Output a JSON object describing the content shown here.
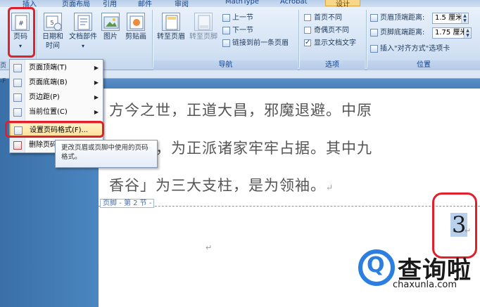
{
  "tabs": [
    {
      "label": "插入"
    },
    {
      "label": "页面布局"
    },
    {
      "label": "引用"
    },
    {
      "label": "邮件"
    },
    {
      "label": "审阅"
    },
    {
      "label": "MathType"
    },
    {
      "label": "Acrobat"
    },
    {
      "label": "设计"
    }
  ],
  "ribbon": {
    "header_footer": {
      "page_number_label": "页码",
      "page_number_arrow": "▾"
    },
    "insert": {
      "datetime_label": "日期和\n时间",
      "quickparts_label": "文档部件",
      "quickparts_arrow": "▾",
      "picture_label": "图片",
      "clipart_label": "剪贴画"
    },
    "navigation": {
      "goto_header_label": "转至页眉",
      "goto_footer_label": "转至页脚",
      "prev_section_label": "上一节",
      "next_section_label": "下一节",
      "link_prev_label": "链接到前一条页眉",
      "title": "导航"
    },
    "options": {
      "diff_first_label": "首页不同",
      "diff_first_checked": false,
      "diff_oddeven_label": "奇偶页不同",
      "diff_oddeven_checked": false,
      "show_text_label": "显示文档文字",
      "show_text_checked": true,
      "title": "选项"
    },
    "position": {
      "header_from_top_label": "页眉顶端距离:",
      "header_from_top_value": "1.5 厘米",
      "footer_from_bottom_label": "页脚底端距离:",
      "footer_from_bottom_value": "1.75 厘米",
      "insert_align_tab_label": "插入\"对齐方式\"选项卡",
      "title": "位置"
    }
  },
  "left_labels": {
    "top": "页",
    "ruler": "-F"
  },
  "menu": {
    "items": [
      {
        "label": "页面顶端(T)",
        "has_sub": true
      },
      {
        "label": "页面底端(B)",
        "has_sub": true
      },
      {
        "label": "页边距(P)",
        "has_sub": true
      },
      {
        "label": "当前位置(C)",
        "has_sub": true
      },
      {
        "label": "设置页码格式(F)...",
        "has_sub": false
      },
      {
        "label": "删除页码",
        "has_sub": false
      }
    ],
    "submenu_arrow": "▶"
  },
  "tooltip": {
    "text": "更改页眉或页脚中使用的页码格式。"
  },
  "document": {
    "lines": [
      "方今之世，正道大昌，邪魔退避。中原",
      "产丰富，为正派诸家牢牢占据。其中九",
      "香谷」为三大支柱，是为领袖。"
    ],
    "para_mark": "↵",
    "footer_tag": "页脚 - 第 2 节 -",
    "page_number": "3"
  },
  "watermark": {
    "brand": "查询啦",
    "url": "chaxunla.com",
    "q": "Q"
  }
}
